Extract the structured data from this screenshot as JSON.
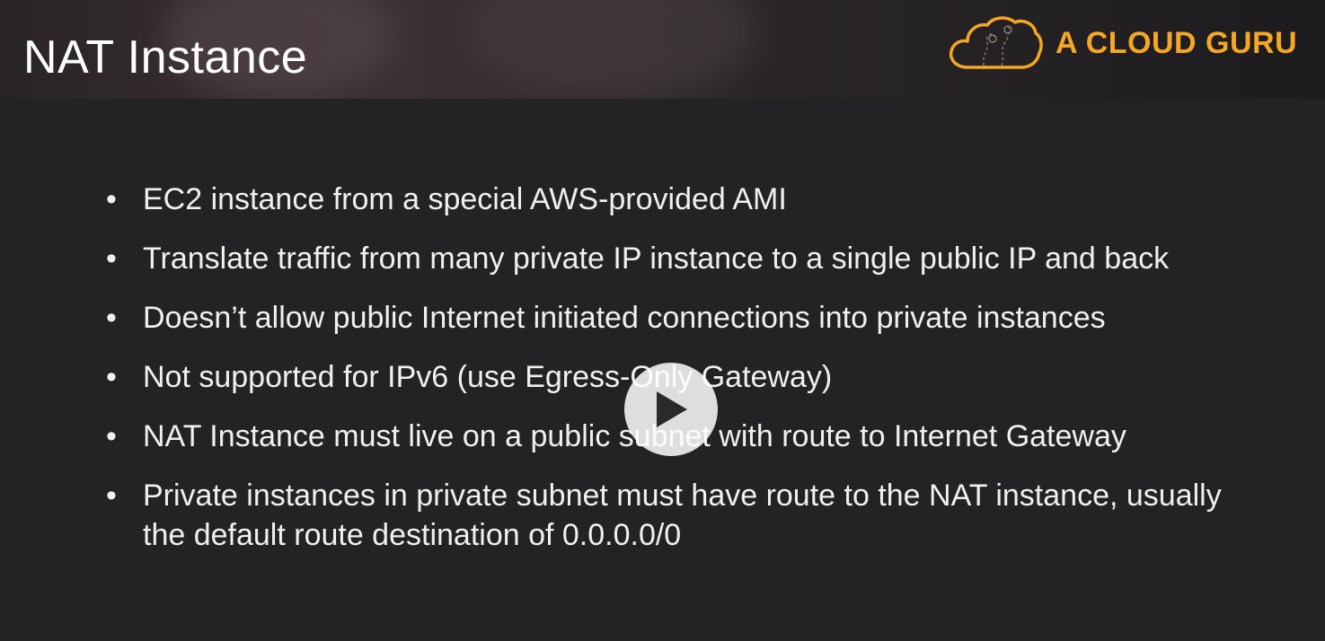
{
  "slide": {
    "title": "NAT Instance",
    "brand": "A CLOUD GURU",
    "bullets": [
      "EC2 instance from a special AWS-provided AMI",
      "Translate traffic from many private IP instance to a single public IP and back",
      "Doesn’t allow public Internet initiated connections into private instances",
      "Not supported for IPv6 (use Egress-Only Gateway)",
      "NAT Instance must live on a public subnet with route to Internet Gateway",
      "Private instances in private subnet must have route to the NAT instance, usually the default route destination of 0.0.0.0/0"
    ],
    "bullet_symbol": "•"
  },
  "player": {
    "play_icon": "play-icon"
  },
  "colors": {
    "background": "#232224",
    "brand": "#f5a623",
    "text": "#f0f0f0"
  }
}
